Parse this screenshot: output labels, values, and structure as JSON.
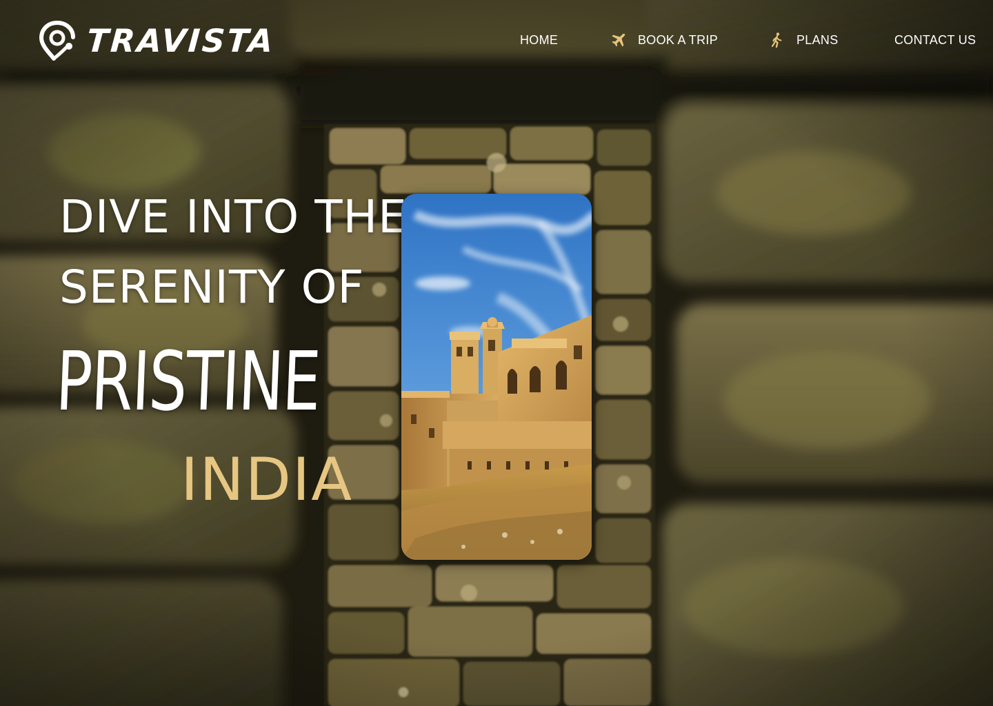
{
  "brand": {
    "name": "TRAVISTA",
    "logo_icon": "location-pin-icon"
  },
  "nav": {
    "items": [
      {
        "label": "HOME",
        "icon": ""
      },
      {
        "label": "BOOK A TRIP",
        "icon": "airplane-icon"
      },
      {
        "label": "PLANS",
        "icon": "walking-person-icon"
      },
      {
        "label": "CONTACT US",
        "icon": ""
      }
    ]
  },
  "hero": {
    "line1": "DIVE INTO THE",
    "line2": "SERENITY OF",
    "script_word": "PRISTINE",
    "accent_word": "INDIA"
  },
  "colors": {
    "accent_gold": "#e6c682",
    "icon_gold": "#e7c47c",
    "text_white": "#ffffff"
  }
}
